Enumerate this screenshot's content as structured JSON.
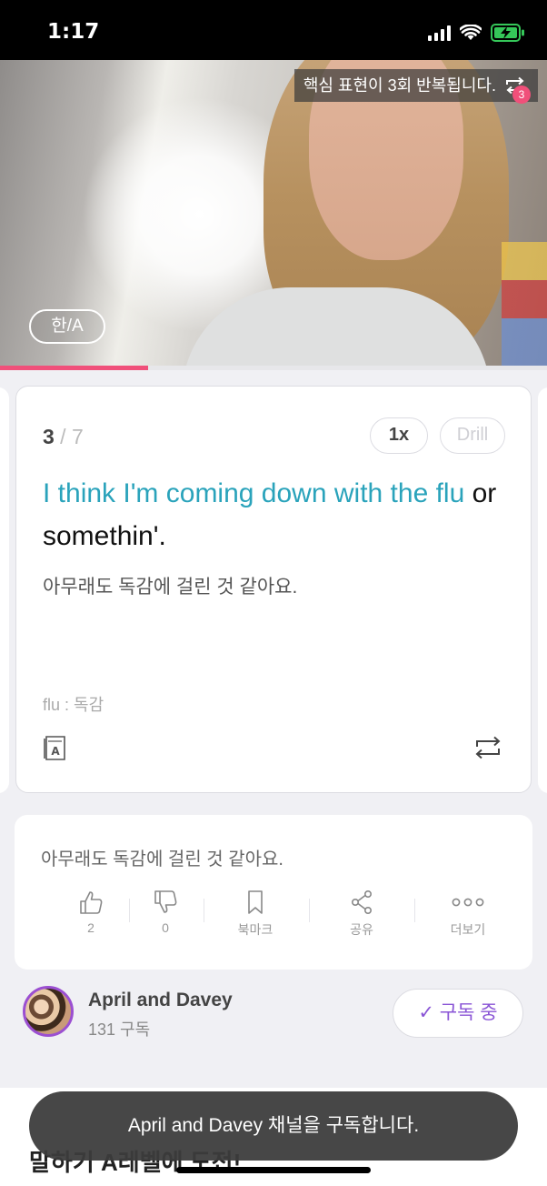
{
  "status_bar": {
    "time": "1:17",
    "icons": [
      "signal-icon",
      "wifi-icon",
      "battery-charging-icon"
    ]
  },
  "video": {
    "repeat_banner": "핵심 표현이 3회 반복됩니다.",
    "repeat_count": "3",
    "lang_toggle": "한/A",
    "progress_fraction": 0.27
  },
  "card": {
    "counter_current": "3",
    "counter_total": " / 7",
    "speed_label": "1x",
    "drill_label": "Drill",
    "sentence_highlight": "I think I'm coming down with the flu",
    "sentence_rest": " or somethin'.",
    "translation": "아무래도 독감에 걸린 것 같아요.",
    "vocab": "flu : 독감",
    "icons": [
      "dictionary-icon",
      "repeat-loop-icon"
    ]
  },
  "panel": {
    "text": "아무래도 독감에 걸린 것 같아요.",
    "actions": [
      {
        "icon": "thumbs-up-icon",
        "label": "2"
      },
      {
        "icon": "thumbs-down-icon",
        "label": "0"
      },
      {
        "icon": "bookmark-icon",
        "label": "북마크"
      },
      {
        "icon": "share-icon",
        "label": "공유"
      },
      {
        "icon": "more-icon",
        "label": "더보기"
      }
    ]
  },
  "channel": {
    "name": "April and Davey",
    "subscribers": "131 구독",
    "subscribe_label": "✓ 구독 중"
  },
  "section_heading": "말하기 A레벨에 도전!",
  "toast": "April and Davey 채널을 구독합니다.",
  "colors": {
    "accent_pink": "#f0507a",
    "highlight_teal": "#2aa3bb",
    "subscribe_purple": "#8a55d6"
  }
}
